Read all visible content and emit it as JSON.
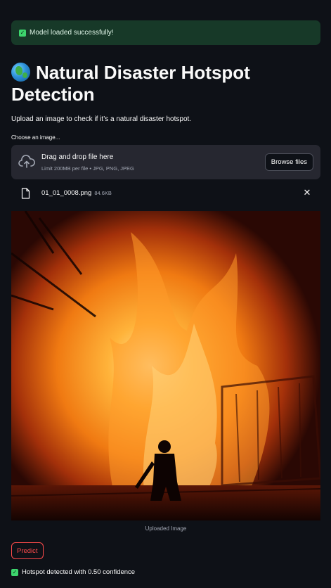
{
  "status": {
    "model_loaded": "Model loaded successfully!"
  },
  "header": {
    "title": "Natural Disaster Hotspot Detection",
    "title_icon": "globe-icon"
  },
  "intro": "Upload an image to check if it’s a natural disaster hotspot.",
  "uploader": {
    "label": "Choose an image...",
    "drop_title": "Drag and drop file here",
    "limit_text": "Limit 200MB per file • JPG, PNG, JPEG",
    "browse_label": "Browse files"
  },
  "uploaded_file": {
    "name": "01_01_0008.png",
    "size": "84.6KB"
  },
  "image": {
    "caption": "Uploaded Image"
  },
  "actions": {
    "predict_label": "Predict"
  },
  "result": {
    "text": "Hotspot detected with 0.50 confidence"
  },
  "colors": {
    "background": "#0e1117",
    "success_bg": "#173928",
    "primary": "#ff4b4b",
    "surface": "#262730",
    "check": "#3dd56d"
  }
}
